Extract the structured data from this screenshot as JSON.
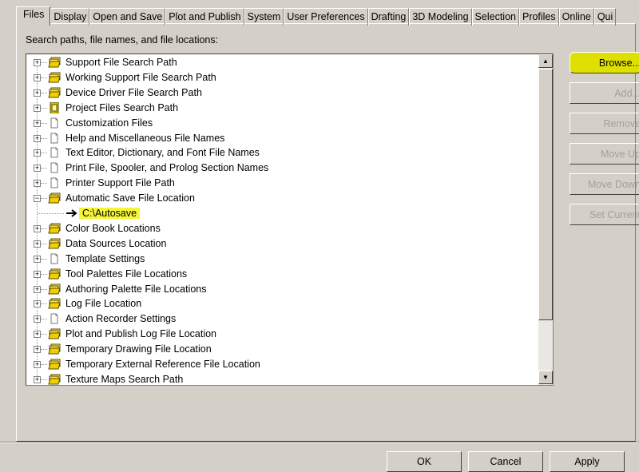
{
  "tabs": [
    "Files",
    "Display",
    "Open and Save",
    "Plot and Publish",
    "System",
    "User Preferences",
    "Drafting",
    "3D Modeling",
    "Selection",
    "Profiles",
    "Online",
    "Qui"
  ],
  "tree_label": "Search paths, file names, and file locations:",
  "tree_items": [
    {
      "label": "Support File Search Path",
      "icon": "folders",
      "expanded": false
    },
    {
      "label": "Working Support File Search Path",
      "icon": "folders",
      "expanded": false
    },
    {
      "label": "Device Driver File Search Path",
      "icon": "folders",
      "expanded": false
    },
    {
      "label": "Project Files Search Path",
      "icon": "project",
      "expanded": false
    },
    {
      "label": "Customization Files",
      "icon": "document",
      "expanded": false
    },
    {
      "label": "Help and Miscellaneous File Names",
      "icon": "document",
      "expanded": false
    },
    {
      "label": "Text Editor, Dictionary, and Font File Names",
      "icon": "document",
      "expanded": false
    },
    {
      "label": "Print File, Spooler, and Prolog Section Names",
      "icon": "document",
      "expanded": false
    },
    {
      "label": "Printer Support File Path",
      "icon": "document",
      "expanded": false
    },
    {
      "label": "Automatic Save File Location",
      "icon": "folders",
      "expanded": true
    },
    {
      "label": "C:\\Autosave",
      "icon": "arrow",
      "child": true
    },
    {
      "label": "Color Book Locations",
      "icon": "folders",
      "expanded": false
    },
    {
      "label": "Data Sources Location",
      "icon": "folders",
      "expanded": false
    },
    {
      "label": "Template Settings",
      "icon": "document",
      "expanded": false
    },
    {
      "label": "Tool Palettes File Locations",
      "icon": "folders",
      "expanded": false
    },
    {
      "label": "Authoring Palette File Locations",
      "icon": "folders",
      "expanded": false
    },
    {
      "label": "Log File Location",
      "icon": "folders",
      "expanded": false
    },
    {
      "label": "Action Recorder Settings",
      "icon": "document",
      "expanded": false
    },
    {
      "label": "Plot and Publish Log File Location",
      "icon": "folders",
      "expanded": false
    },
    {
      "label": "Temporary Drawing File Location",
      "icon": "folders",
      "expanded": false
    },
    {
      "label": "Temporary External Reference File Location",
      "icon": "folders",
      "expanded": false
    },
    {
      "label": "Texture Maps Search Path",
      "icon": "folders",
      "expanded": false
    }
  ],
  "side_buttons": [
    {
      "label": "Browse...",
      "enabled": true
    },
    {
      "label": "Add...",
      "enabled": false
    },
    {
      "label": "Remove",
      "enabled": false
    },
    {
      "label": "Move Up",
      "enabled": false
    },
    {
      "label": "Move Down",
      "enabled": false
    },
    {
      "label": "Set Current",
      "enabled": false
    }
  ],
  "bottom_buttons": [
    "OK",
    "Cancel",
    "Apply"
  ],
  "highlight_color": "#f5f53a"
}
